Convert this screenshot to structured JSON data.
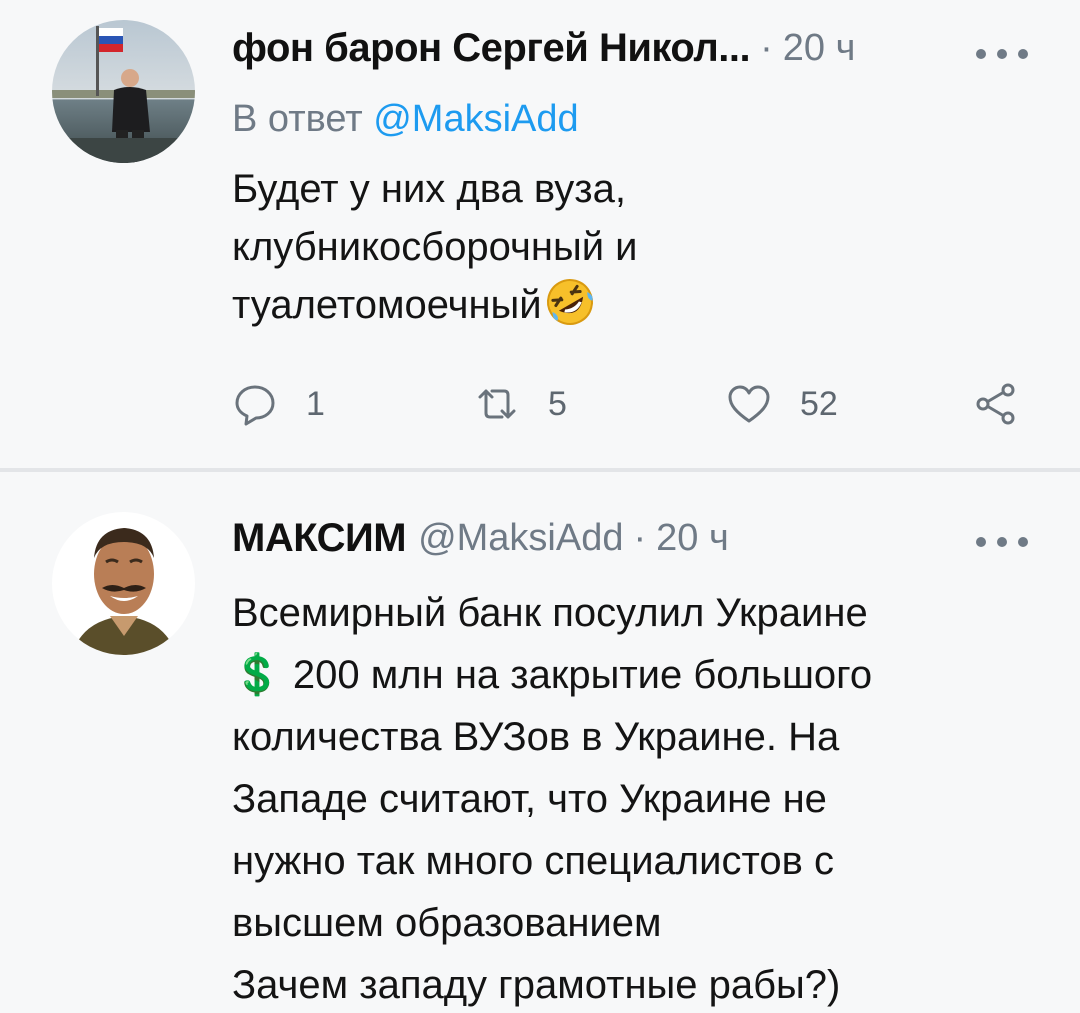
{
  "tweets": [
    {
      "author_name": "фон барон Сергей Никол...",
      "time": "20 ч",
      "time_separator": "·",
      "reply_to_prefix": "В ответ",
      "reply_to_mention": "@MaksiAdd",
      "text_lines": [
        "Будет у них два вуза,",
        "клубникосборочный и",
        "туалетомоечный"
      ],
      "emoji": "rolling-on-floor-laughing",
      "more_icon": "more-dots-icon",
      "actions": {
        "reply_count": "1",
        "retweet_count": "5",
        "like_count": "52"
      }
    },
    {
      "author_name": "МАКСИМ",
      "author_handle": "@MaksiAdd",
      "time_separator": "·",
      "time": "20 ч",
      "more_icon": "more-dots-icon",
      "text_lines": [
        "Всемирный банк посулил Украине",
        "💲 200 млн на закрытие большого",
        "количества ВУЗов в Украине. На",
        "Западе считают, что Украине не",
        "нужно так много специалистов с",
        "высшем образованием",
        "Зачем западу грамотные рабы?)"
      ]
    }
  ],
  "colors": {
    "background": "#f7f8f9",
    "secondary_text": "#6f7a86",
    "mention": "#1d9bf0",
    "divider": "#e3e5e8"
  }
}
